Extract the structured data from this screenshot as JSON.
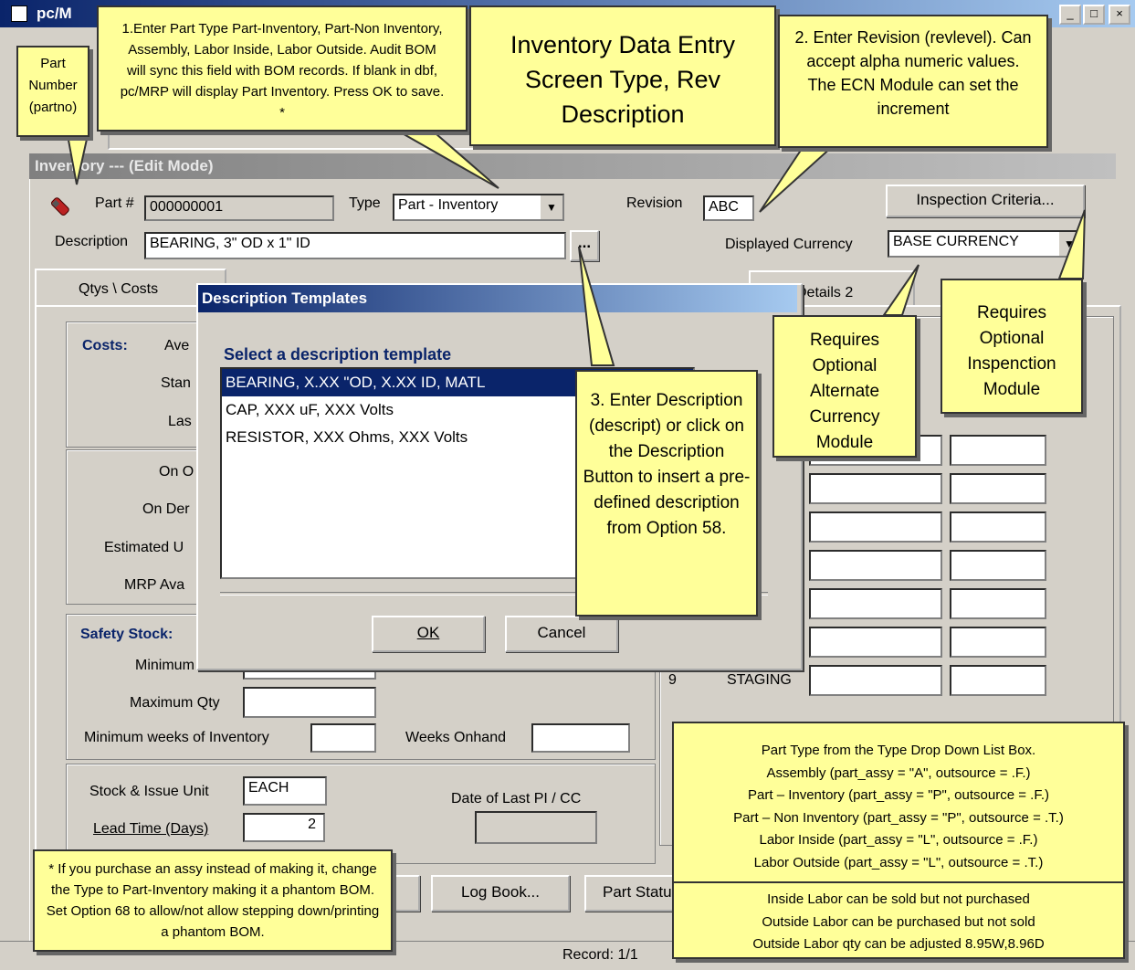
{
  "window": {
    "title": "pc/M",
    "min": "_",
    "max": "□",
    "close": "×"
  },
  "edit_title": "Inventory --- (Edit Mode)",
  "form": {
    "part_label": "Part #",
    "part_value": "000000001",
    "type_label": "Type",
    "type_value": "Part - Inventory",
    "revision_label": "Revision",
    "revision_value": "ABC",
    "inspection_button": "Inspection Criteria...",
    "description_label": "Description",
    "description_value": "BEARING, 3\" OD x 1\" ID",
    "desc_button": "...",
    "currency_label": "Displayed Currency",
    "currency_value": "BASE CURRENCY"
  },
  "tabs": {
    "tab1": "Qtys \\ Costs",
    "tab_details2": "Details 2"
  },
  "left": {
    "costs": "Costs:",
    "ave": "Ave",
    "stan": "Stan",
    "las": "Las",
    "on_o": "On O",
    "on_der": "On Der",
    "estimated": "Estimated U",
    "mrp": "MRP Ava",
    "safety": "Safety Stock:",
    "minimum": "Minimum",
    "max_qty": "Maximum Qty",
    "min_weeks": "Minimum weeks of Inventory",
    "weeks_onhand": "Weeks Onhand",
    "stock_issue": "Stock & Issue Unit",
    "stock_issue_value": "EACH",
    "lead_time": "Lead Time (Days)",
    "lead_time_value": "2",
    "date_last": "Date of Last PI / CC"
  },
  "right": {
    "row9_num": "9",
    "row9_name": "STAGING"
  },
  "bottom": {
    "log_book": "Log Book...",
    "part_status": "Part Statu",
    "record": "Record: 1/1"
  },
  "dialog": {
    "title": "Description Templates",
    "heading": "Select a description template",
    "items": [
      "BEARING, X.XX \"OD, X.XX ID, MATL",
      "CAP, XXX uF, XXX Volts",
      "RESISTOR, XXX Ohms, XXX Volts"
    ],
    "ok": "OK",
    "cancel": "Cancel"
  },
  "callouts": {
    "part_number": "Part Number (partno)",
    "type_info": "1.Enter Part Type Part-Inventory, Part-Non Inventory, Assembly, Labor Inside, Labor Outside.  Audit BOM will sync this field with BOM records.  If blank in dbf, pc/MRP will display Part Inventory.  Press OK to save. *",
    "heading": "Inventory Data Entry Screen Type, Rev Description",
    "revision": "2. Enter Revision (revlevel). Can accept alpha numeric values.  The ECN Module can set the increment",
    "description": "3. Enter Description (descript) or click on the Description Button to insert a pre-defined description from Option 58.",
    "currency": "Requires Optional Alternate Currency Module",
    "inspection": "Requires Optional Inspenction Module",
    "assy": "* If you purchase an assy instead of making it, change the Type to Part-Inventory making it a phantom BOM.  Set Option 68 to allow/not allow stepping down/printing a phantom BOM.",
    "part_type_lines": [
      "Part Type from the Type Drop Down List Box.",
      "Assembly (part_assy = \"A\", outsource = .F.)",
      "Part – Inventory (part_assy = \"P\", outsource = .F.)",
      "Part – Non Inventory (part_assy = \"P\", outsource = .T.)",
      "Labor Inside (part_assy = \"L\", outsource = .F.)",
      "Labor Outside (part_assy = \"L\", outsource = .T.)"
    ],
    "labor_lines": [
      "Inside Labor can be sold but not purchased",
      "Outside Labor can be purchased but not sold",
      "Outside Labor qty can be adjusted 8.95W,8.96D"
    ]
  }
}
